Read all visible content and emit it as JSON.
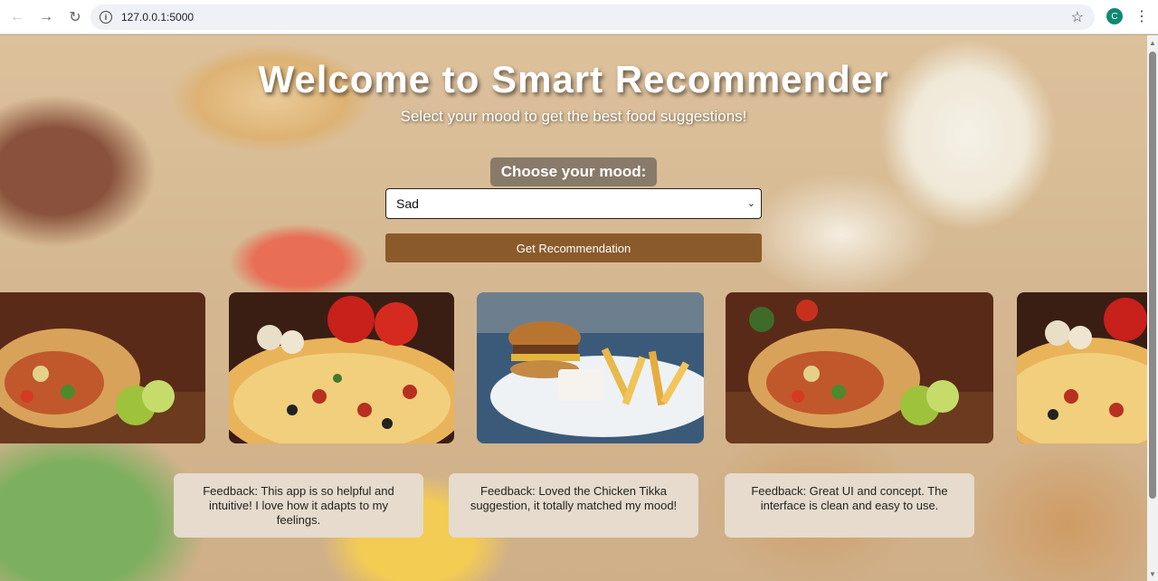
{
  "browser": {
    "url": "127.0.0.1:5000",
    "profile_initial": "C",
    "icons": [
      "back-arrow-icon",
      "forward-arrow-icon",
      "reload-icon",
      "info-icon",
      "star-icon",
      "kebab-menu-icon"
    ]
  },
  "header": {
    "title": "Welcome to Smart Recommender",
    "subtitle": "Select your mood to get the best food suggestions!"
  },
  "mood": {
    "label": "Choose your mood:",
    "selected": "Sad"
  },
  "recommend_button": "Get Recommendation",
  "carousel": {
    "items": [
      "wrap",
      "pizza",
      "burger-fries",
      "wrap",
      "pizza"
    ]
  },
  "feedback": [
    "Feedback: This app is so helpful and intuitive! I love how it adapts to my feelings.",
    "Feedback: Loved the Chicken Tikka suggestion, it totally matched my mood!",
    "Feedback: Great UI and concept. The interface is clean and easy to use."
  ],
  "colors": {
    "button": "#8b5a2b",
    "feedback_bg": "#e6dbcc",
    "profile": "#0f8a72"
  }
}
